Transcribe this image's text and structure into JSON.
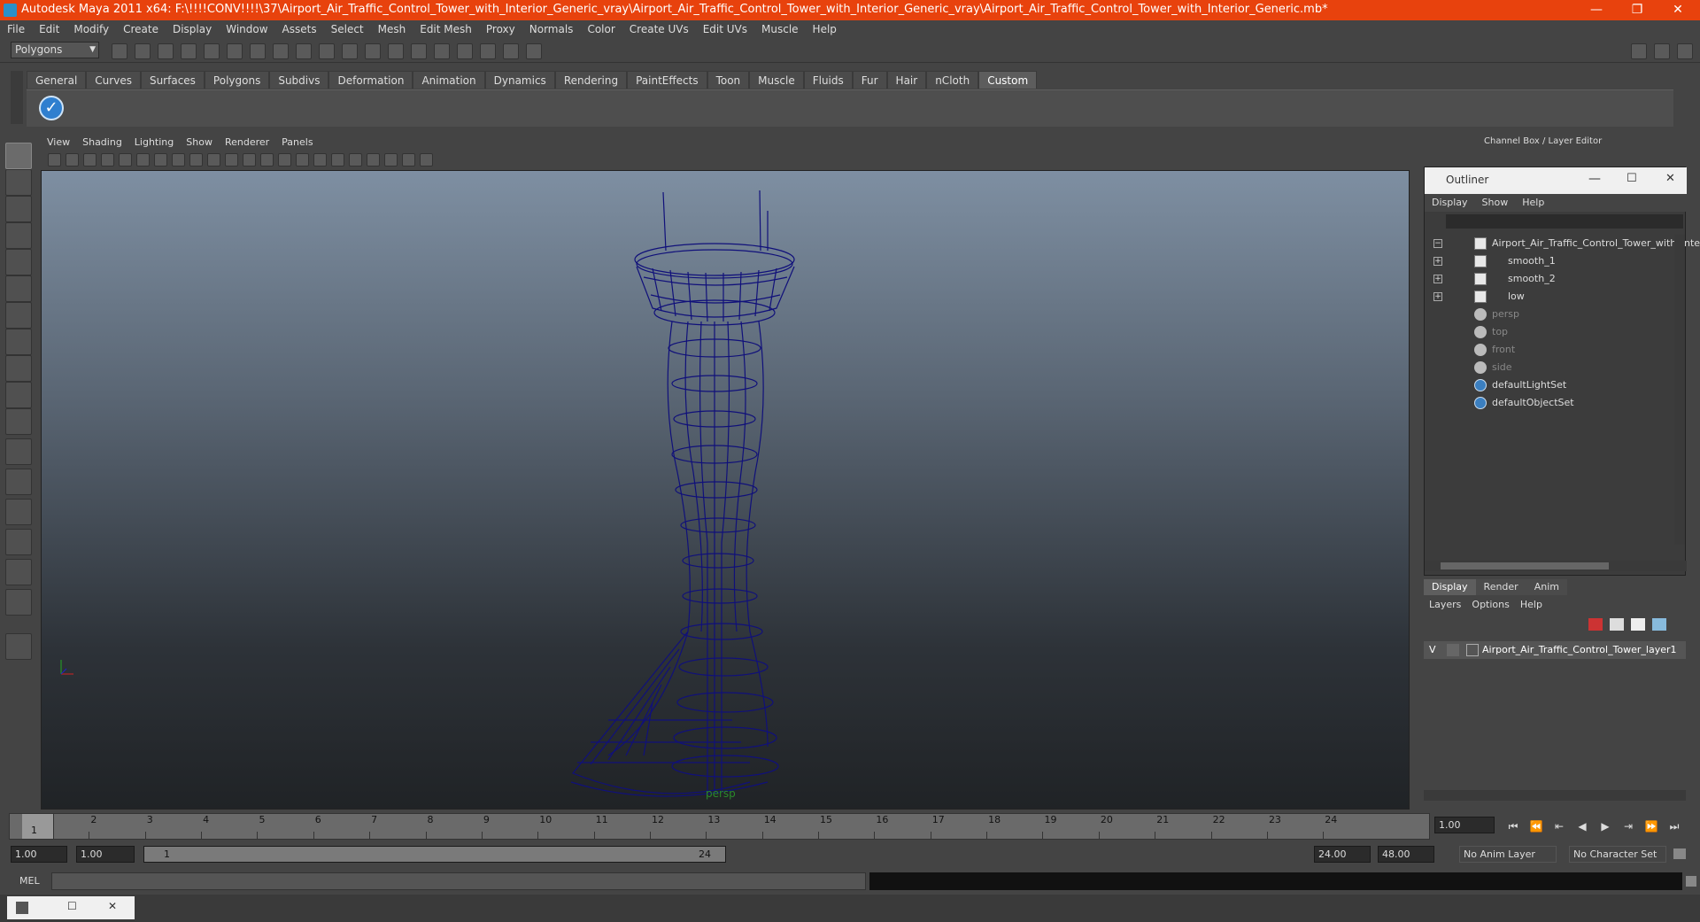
{
  "window": {
    "title": "Autodesk Maya 2011 x64: F:\\!!!!CONV!!!!\\37\\Airport_Air_Traffic_Control_Tower_with_Interior_Generic_vray\\Airport_Air_Traffic_Control_Tower_with_Interior_Generic_vray\\Airport_Air_Traffic_Control_Tower_with_Interior_Generic.mb*",
    "minimize": "—",
    "restore": "❐",
    "close": "✕"
  },
  "menubar": [
    "File",
    "Edit",
    "Modify",
    "Create",
    "Display",
    "Window",
    "Assets",
    "Select",
    "Mesh",
    "Edit Mesh",
    "Proxy",
    "Normals",
    "Color",
    "Create UVs",
    "Edit UVs",
    "Muscle",
    "Help"
  ],
  "statusline": {
    "mode": "Polygons"
  },
  "shelf": {
    "tabs": [
      "General",
      "Curves",
      "Surfaces",
      "Polygons",
      "Subdivs",
      "Deformation",
      "Animation",
      "Dynamics",
      "Rendering",
      "PaintEffects",
      "Toon",
      "Muscle",
      "Fluids",
      "Fur",
      "Hair",
      "nCloth",
      "Custom"
    ],
    "active": "Custom"
  },
  "viewport": {
    "menu": [
      "View",
      "Shading",
      "Lighting",
      "Show",
      "Renderer",
      "Panels"
    ],
    "camera_label": "persp"
  },
  "channel_box": {
    "title": "Channel Box / Layer Editor"
  },
  "outliner": {
    "title": "Outliner",
    "menu": [
      "Display",
      "Show",
      "Help"
    ],
    "items": [
      {
        "label": "Airport_Air_Traffic_Control_Tower_with_Inte",
        "type": "mesh",
        "expander": "−",
        "dim": false
      },
      {
        "label": "smooth_1",
        "type": "mesh",
        "expander": "+",
        "dim": false
      },
      {
        "label": "smooth_2",
        "type": "mesh",
        "expander": "+",
        "dim": false
      },
      {
        "label": "low",
        "type": "mesh",
        "expander": "+",
        "dim": false
      },
      {
        "label": "persp",
        "type": "camera",
        "expander": "",
        "dim": true
      },
      {
        "label": "top",
        "type": "camera",
        "expander": "",
        "dim": true
      },
      {
        "label": "front",
        "type": "camera",
        "expander": "",
        "dim": true
      },
      {
        "label": "side",
        "type": "camera",
        "expander": "",
        "dim": true
      },
      {
        "label": "defaultLightSet",
        "type": "set",
        "expander": "",
        "dim": false
      },
      {
        "label": "defaultObjectSet",
        "type": "set",
        "expander": "",
        "dim": false
      }
    ]
  },
  "layer_editor": {
    "tabs": [
      "Display",
      "Render",
      "Anim"
    ],
    "active": "Display",
    "menu": [
      "Layers",
      "Options",
      "Help"
    ],
    "layer": {
      "visible": "V",
      "name": "Airport_Air_Traffic_Control_Tower_layer1"
    }
  },
  "timeline": {
    "ticks": [
      "1",
      "2",
      "3",
      "4",
      "5",
      "6",
      "7",
      "8",
      "9",
      "10",
      "11",
      "12",
      "13",
      "14",
      "15",
      "16",
      "17",
      "18",
      "19",
      "20",
      "21",
      "22",
      "23",
      "24"
    ],
    "current_frame_marker": "1",
    "current_time": "1.00"
  },
  "range": {
    "start": "1.00",
    "playback_start": "1.00",
    "slider_start": "1",
    "slider_end": "24",
    "playback_end": "24.00",
    "end": "48.00",
    "anim_layer": "No Anim Layer",
    "character_set": "No Character Set"
  },
  "cmdline": {
    "label": "MEL"
  }
}
